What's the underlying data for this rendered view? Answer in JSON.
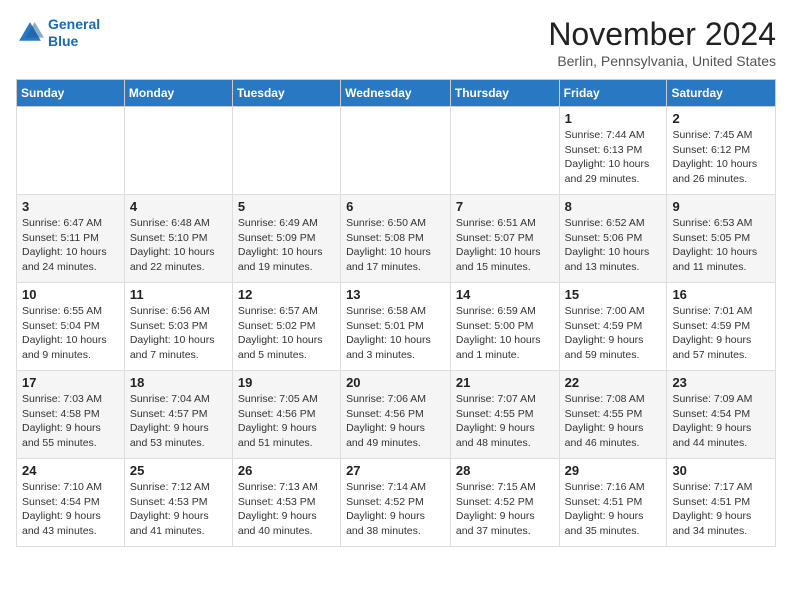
{
  "logo": {
    "line1": "General",
    "line2": "Blue"
  },
  "title": "November 2024",
  "location": "Berlin, Pennsylvania, United States",
  "weekdays": [
    "Sunday",
    "Monday",
    "Tuesday",
    "Wednesday",
    "Thursday",
    "Friday",
    "Saturday"
  ],
  "weeks": [
    [
      {
        "day": "",
        "info": ""
      },
      {
        "day": "",
        "info": ""
      },
      {
        "day": "",
        "info": ""
      },
      {
        "day": "",
        "info": ""
      },
      {
        "day": "",
        "info": ""
      },
      {
        "day": "1",
        "info": "Sunrise: 7:44 AM\nSunset: 6:13 PM\nDaylight: 10 hours and 29 minutes."
      },
      {
        "day": "2",
        "info": "Sunrise: 7:45 AM\nSunset: 6:12 PM\nDaylight: 10 hours and 26 minutes."
      }
    ],
    [
      {
        "day": "3",
        "info": "Sunrise: 6:47 AM\nSunset: 5:11 PM\nDaylight: 10 hours and 24 minutes."
      },
      {
        "day": "4",
        "info": "Sunrise: 6:48 AM\nSunset: 5:10 PM\nDaylight: 10 hours and 22 minutes."
      },
      {
        "day": "5",
        "info": "Sunrise: 6:49 AM\nSunset: 5:09 PM\nDaylight: 10 hours and 19 minutes."
      },
      {
        "day": "6",
        "info": "Sunrise: 6:50 AM\nSunset: 5:08 PM\nDaylight: 10 hours and 17 minutes."
      },
      {
        "day": "7",
        "info": "Sunrise: 6:51 AM\nSunset: 5:07 PM\nDaylight: 10 hours and 15 minutes."
      },
      {
        "day": "8",
        "info": "Sunrise: 6:52 AM\nSunset: 5:06 PM\nDaylight: 10 hours and 13 minutes."
      },
      {
        "day": "9",
        "info": "Sunrise: 6:53 AM\nSunset: 5:05 PM\nDaylight: 10 hours and 11 minutes."
      }
    ],
    [
      {
        "day": "10",
        "info": "Sunrise: 6:55 AM\nSunset: 5:04 PM\nDaylight: 10 hours and 9 minutes."
      },
      {
        "day": "11",
        "info": "Sunrise: 6:56 AM\nSunset: 5:03 PM\nDaylight: 10 hours and 7 minutes."
      },
      {
        "day": "12",
        "info": "Sunrise: 6:57 AM\nSunset: 5:02 PM\nDaylight: 10 hours and 5 minutes."
      },
      {
        "day": "13",
        "info": "Sunrise: 6:58 AM\nSunset: 5:01 PM\nDaylight: 10 hours and 3 minutes."
      },
      {
        "day": "14",
        "info": "Sunrise: 6:59 AM\nSunset: 5:00 PM\nDaylight: 10 hours and 1 minute."
      },
      {
        "day": "15",
        "info": "Sunrise: 7:00 AM\nSunset: 4:59 PM\nDaylight: 9 hours and 59 minutes."
      },
      {
        "day": "16",
        "info": "Sunrise: 7:01 AM\nSunset: 4:59 PM\nDaylight: 9 hours and 57 minutes."
      }
    ],
    [
      {
        "day": "17",
        "info": "Sunrise: 7:03 AM\nSunset: 4:58 PM\nDaylight: 9 hours and 55 minutes."
      },
      {
        "day": "18",
        "info": "Sunrise: 7:04 AM\nSunset: 4:57 PM\nDaylight: 9 hours and 53 minutes."
      },
      {
        "day": "19",
        "info": "Sunrise: 7:05 AM\nSunset: 4:56 PM\nDaylight: 9 hours and 51 minutes."
      },
      {
        "day": "20",
        "info": "Sunrise: 7:06 AM\nSunset: 4:56 PM\nDaylight: 9 hours and 49 minutes."
      },
      {
        "day": "21",
        "info": "Sunrise: 7:07 AM\nSunset: 4:55 PM\nDaylight: 9 hours and 48 minutes."
      },
      {
        "day": "22",
        "info": "Sunrise: 7:08 AM\nSunset: 4:55 PM\nDaylight: 9 hours and 46 minutes."
      },
      {
        "day": "23",
        "info": "Sunrise: 7:09 AM\nSunset: 4:54 PM\nDaylight: 9 hours and 44 minutes."
      }
    ],
    [
      {
        "day": "24",
        "info": "Sunrise: 7:10 AM\nSunset: 4:54 PM\nDaylight: 9 hours and 43 minutes."
      },
      {
        "day": "25",
        "info": "Sunrise: 7:12 AM\nSunset: 4:53 PM\nDaylight: 9 hours and 41 minutes."
      },
      {
        "day": "26",
        "info": "Sunrise: 7:13 AM\nSunset: 4:53 PM\nDaylight: 9 hours and 40 minutes."
      },
      {
        "day": "27",
        "info": "Sunrise: 7:14 AM\nSunset: 4:52 PM\nDaylight: 9 hours and 38 minutes."
      },
      {
        "day": "28",
        "info": "Sunrise: 7:15 AM\nSunset: 4:52 PM\nDaylight: 9 hours and 37 minutes."
      },
      {
        "day": "29",
        "info": "Sunrise: 7:16 AM\nSunset: 4:51 PM\nDaylight: 9 hours and 35 minutes."
      },
      {
        "day": "30",
        "info": "Sunrise: 7:17 AM\nSunset: 4:51 PM\nDaylight: 9 hours and 34 minutes."
      }
    ]
  ]
}
